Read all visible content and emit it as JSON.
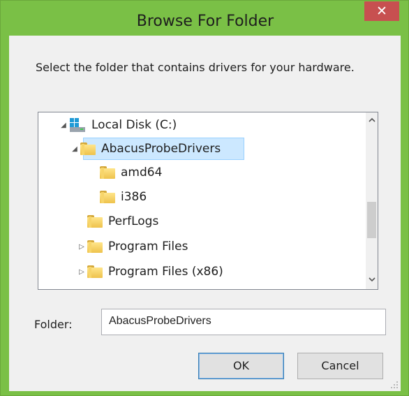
{
  "dialog": {
    "title": "Browse For Folder",
    "close_glyph": "✕",
    "prompt": "Select the folder that contains drivers for your hardware."
  },
  "tree": {
    "items": [
      {
        "label": "Local Disk (C:)",
        "icon": "drive-icon",
        "expander": "expanded"
      },
      {
        "label": "AbacusProbeDrivers",
        "icon": "folder-icon",
        "expander": "expanded",
        "selected": true
      },
      {
        "label": "amd64",
        "icon": "folder-icon",
        "expander": "none"
      },
      {
        "label": "i386",
        "icon": "folder-icon",
        "expander": "none"
      },
      {
        "label": "PerfLogs",
        "icon": "folder-icon",
        "expander": "none"
      },
      {
        "label": "Program Files",
        "icon": "folder-icon",
        "expander": "collapsed"
      },
      {
        "label": "Program Files (x86)",
        "icon": "folder-icon",
        "expander": "collapsed"
      }
    ],
    "scroll_up_glyph": "⌃",
    "scroll_down_glyph": "⌄"
  },
  "folder_field": {
    "label": "Folder:",
    "value": "AbacusProbeDrivers"
  },
  "buttons": {
    "ok": "OK",
    "cancel": "Cancel"
  },
  "colors": {
    "window_frame": "#7ac046",
    "close_button": "#c75050",
    "selection": "#cce8ff"
  }
}
